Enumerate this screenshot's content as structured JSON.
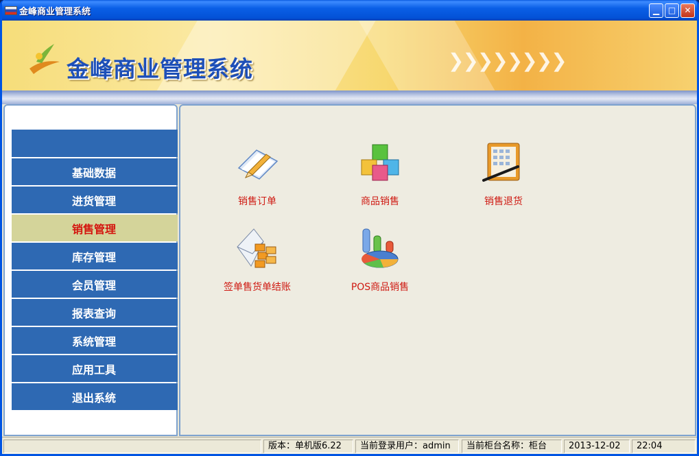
{
  "window": {
    "title": "金峰商业管理系统"
  },
  "banner": {
    "title": "金峰商业管理系统",
    "chevrons": "❯❯❯❯❯❯❯❯"
  },
  "sidebar": {
    "items": [
      {
        "label": "基础数据",
        "active": false
      },
      {
        "label": "进货管理",
        "active": false
      },
      {
        "label": "销售管理",
        "active": true
      },
      {
        "label": "库存管理",
        "active": false
      },
      {
        "label": "会员管理",
        "active": false
      },
      {
        "label": "报表查询",
        "active": false
      },
      {
        "label": "系统管理",
        "active": false
      },
      {
        "label": "应用工具",
        "active": false
      },
      {
        "label": "退出系统",
        "active": false
      }
    ]
  },
  "main": {
    "tiles": [
      {
        "label": "销售订单",
        "icon": "sales-order-icon"
      },
      {
        "label": "商品销售",
        "icon": "product-sales-icon"
      },
      {
        "label": "销售退货",
        "icon": "sales-return-icon"
      },
      {
        "label": "签单售货单结账",
        "icon": "invoice-checkout-icon"
      },
      {
        "label": "POS商品销售",
        "icon": "pos-sales-icon"
      }
    ]
  },
  "status": {
    "version": "版本：单机版6.22",
    "user": "当前登录用户：admin",
    "counter": "当前柜台名称：柜台",
    "date": "2013-12-02",
    "time": "22:04"
  },
  "colors": {
    "menu_bg": "#2e69b3",
    "menu_active_bg": "#d4d49a",
    "tile_label": "#cf1a12",
    "title_blue": "#1d4fb8"
  }
}
